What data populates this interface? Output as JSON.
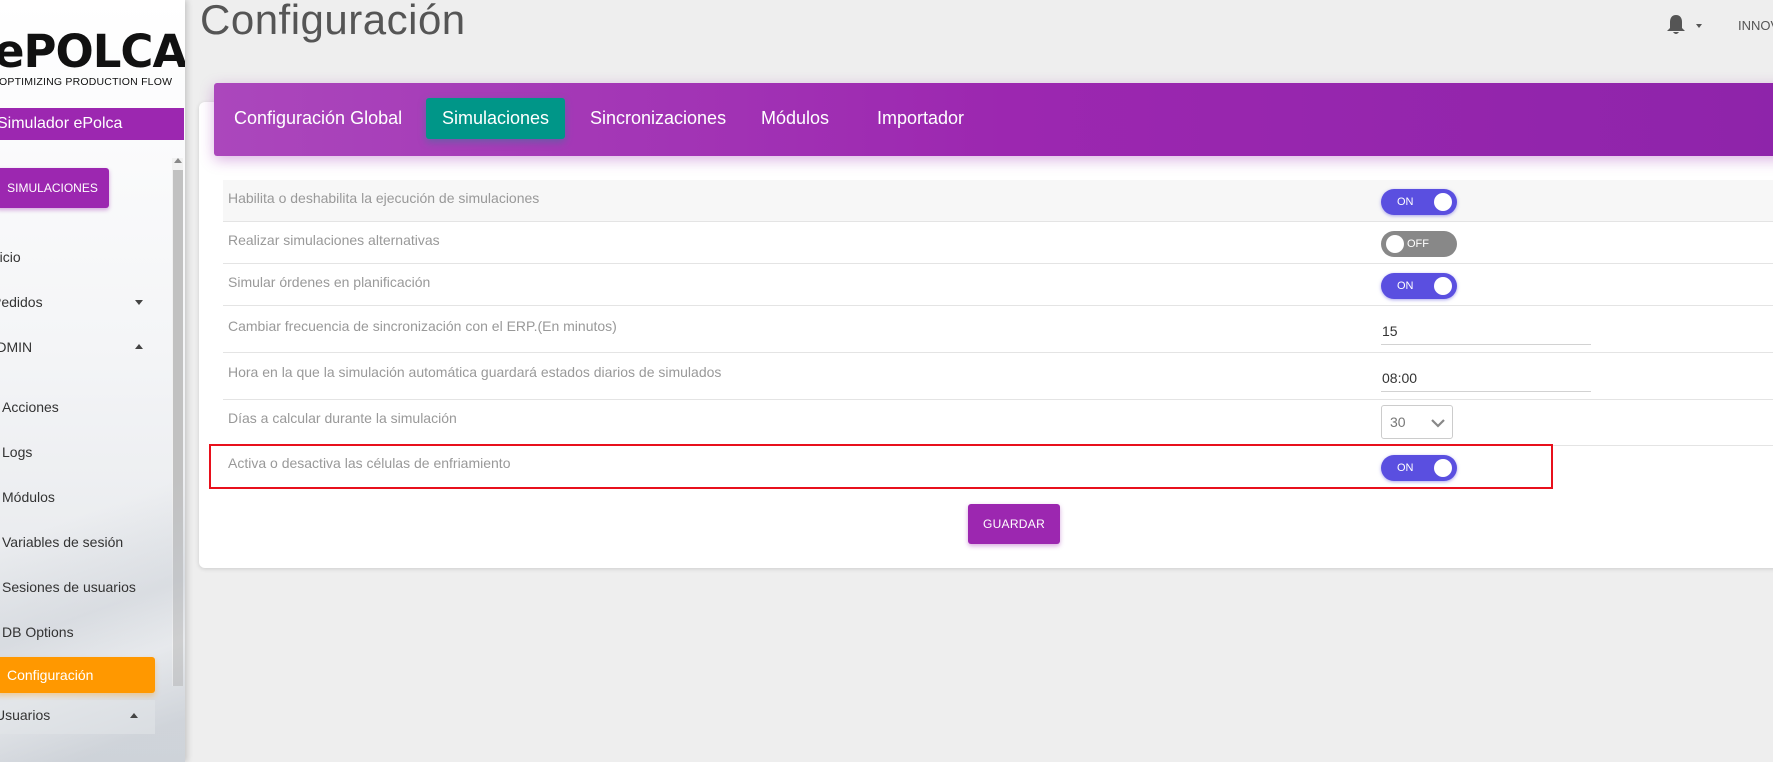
{
  "sidebar": {
    "logo_main": "ePOLCA",
    "logo_sub": "OPTIMIZING PRODUCTION FLOW",
    "app_name": "Simulador ePolca",
    "sim_button": "SIMULACIONES",
    "items": {
      "inicio": "Inicio",
      "pedidos": "Pedidos",
      "admin": "ADMIN",
      "acciones": "Acciones",
      "logs": "Logs",
      "modulos": "Módulos",
      "variables": "Variables de sesión",
      "sesiones": "Sesiones de usuarios",
      "db_options": "DB Options",
      "configuracion": "Configuración",
      "usuarios": "Usuarios"
    }
  },
  "header": {
    "title": "Configuración",
    "user": "INNOV"
  },
  "tabs": {
    "global": "Configuración Global",
    "simulaciones": "Simulaciones",
    "sincronizaciones": "Sincronizaciones",
    "modulos": "Módulos",
    "importador": "Importador"
  },
  "settings": {
    "habilita": {
      "label": "Habilita o deshabilita la ejecución de simulaciones",
      "state": "ON"
    },
    "alternativas": {
      "label": "Realizar simulaciones alternativas",
      "state": "OFF"
    },
    "planificacion": {
      "label": "Simular órdenes en planificación",
      "state": "ON"
    },
    "frecuencia": {
      "label": "Cambiar frecuencia de sincronización con el ERP.(En minutos)",
      "value": "15"
    },
    "hora": {
      "label": "Hora en la que la simulación automática guardará estados diarios de simulados",
      "value": "08:00"
    },
    "dias": {
      "label": "Días a calcular durante la simulación",
      "value": "30"
    },
    "celulas": {
      "label": "Activa o desactiva las células de enfriamiento",
      "state": "ON"
    }
  },
  "save_button": "GUARDAR",
  "colors": {
    "primary": "#9c27b0",
    "tab_active": "#009688",
    "toggle_on": "#5a4fe0",
    "toggle_off": "#888888",
    "active_nav": "#ff9800",
    "highlight": "#e8101c"
  }
}
